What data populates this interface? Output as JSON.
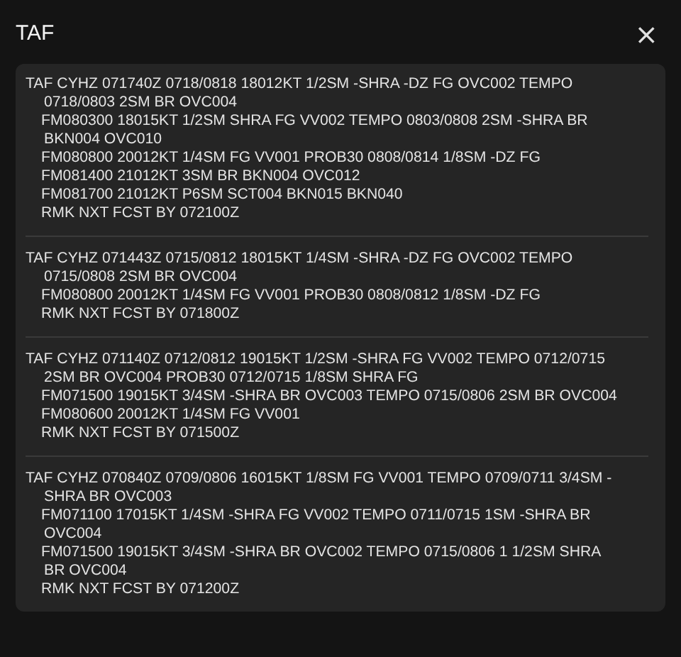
{
  "dialog": {
    "title": "TAF",
    "close": "×"
  },
  "reports": [
    {
      "header": "TAF CYHZ 071740Z 0718/0818 18012KT 1/2SM -SHRA -DZ FG OVC002 TEMPO 0718/0803 2SM BR OVC004",
      "groups": [
        "FM080300 18015KT 1/2SM SHRA FG VV002 TEMPO 0803/0808 2SM -SHRA BR BKN004 OVC010",
        "FM080800 20012KT 1/4SM FG VV001 PROB30 0808/0814 1/8SM -DZ FG",
        "FM081400 21012KT 3SM BR BKN004 OVC012",
        "FM081700 21012KT P6SM SCT004 BKN015 BKN040",
        "RMK NXT FCST BY 072100Z"
      ]
    },
    {
      "header": "TAF CYHZ 071443Z 0715/0812 18015KT 1/4SM -SHRA -DZ FG OVC002 TEMPO 0715/0808 2SM BR OVC004",
      "groups": [
        "FM080800 20012KT 1/4SM FG VV001 PROB30 0808/0812 1/8SM -DZ FG",
        "RMK NXT FCST BY 071800Z"
      ]
    },
    {
      "header": "TAF CYHZ 071140Z 0712/0812 19015KT 1/2SM -SHRA FG VV002 TEMPO 0712/0715 2SM BR OVC004 PROB30 0712/0715 1/8SM SHRA FG",
      "groups": [
        "FM071500 19015KT 3/4SM -SHRA BR OVC003 TEMPO 0715/0806 2SM BR OVC004",
        "FM080600 20012KT 1/4SM FG VV001",
        "RMK NXT FCST BY 071500Z"
      ]
    },
    {
      "header": "TAF CYHZ 070840Z 0709/0806 16015KT 1/8SM FG VV001 TEMPO 0709/0711 3/4SM -SHRA BR OVC003",
      "groups": [
        "FM071100 17015KT 1/4SM -SHRA FG VV002 TEMPO 0711/0715 1SM -SHRA BR OVC004",
        "FM071500 19015KT 3/4SM -SHRA BR OVC002 TEMPO 0715/0806 1 1/2SM SHRA BR OVC004",
        "RMK NXT FCST BY 071200Z"
      ]
    }
  ]
}
